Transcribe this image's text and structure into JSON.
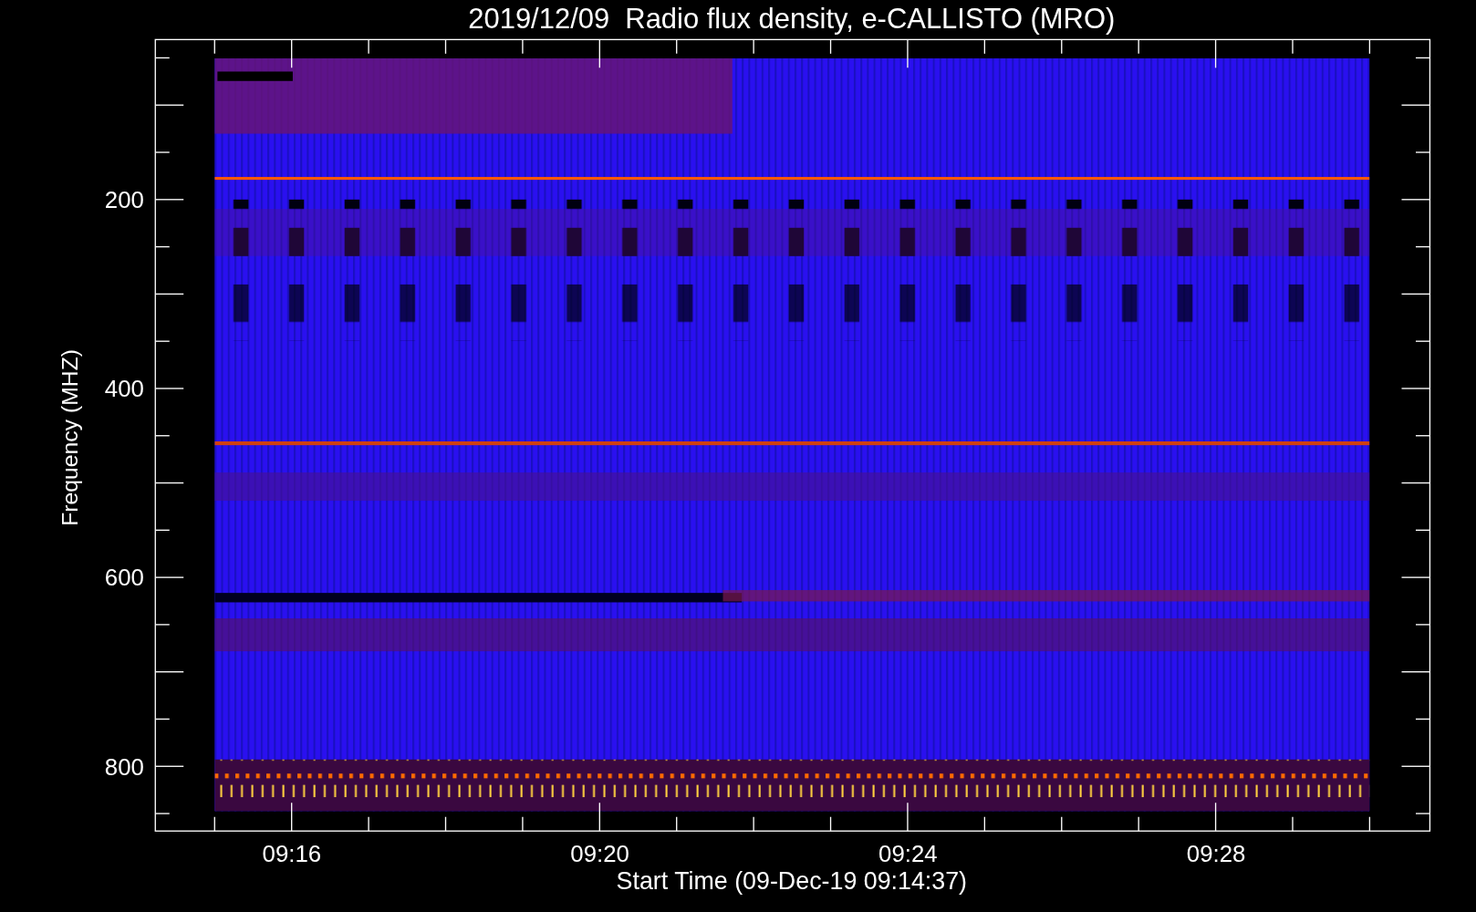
{
  "title": "2019/12/09  Radio flux density, e-CALLISTO (MRO)",
  "y_axis": {
    "label": "Frequency (MHZ)",
    "ticks": [
      "200",
      "400",
      "600",
      "800"
    ]
  },
  "x_axis": {
    "label": "Start Time (09-Dec-19 09:14:37)",
    "ticks": [
      "09:16",
      "09:20",
      "09:24",
      "09:28"
    ]
  }
}
